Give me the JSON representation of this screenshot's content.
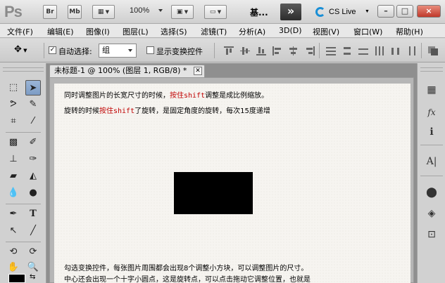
{
  "appbar": {
    "logo": "Ps",
    "bridge_label": "Br",
    "minibridge_label": "Mb",
    "zoom": "100%",
    "workspace": "基...",
    "more_arrow": "»",
    "cslive": "CS Live"
  },
  "window_buttons": {
    "minimize": "–",
    "restore": "□",
    "close": "×"
  },
  "menus": [
    "文件(F)",
    "编辑(E)",
    "图像(I)",
    "图层(L)",
    "选择(S)",
    "滤镜(T)",
    "分析(A)",
    "3D(D)",
    "视图(V)",
    "窗口(W)",
    "帮助(H)"
  ],
  "options": {
    "auto_select_label": "自动选择:",
    "auto_select_checked": true,
    "auto_select_value": "组",
    "show_transform_label": "显示变换控件",
    "show_transform_checked": false
  },
  "document": {
    "tab_title": "未标题-1 @ 100% (图层 1, RGB/8) *",
    "line1_a": "同时调整图片的长宽尺寸的时候，",
    "line1_hl": "按住shift",
    "line1_b": "调整是成比例缩放。",
    "line2_a": "旋转的时候",
    "line2_hl": "按住shift",
    "line2_b": "了旋转，是固定角度的旋转，每次15度递增",
    "line3": "勾选变换控件，每张图片周围都会出现8个调整小方块，可以调整图片的尺寸。",
    "line4": "中心还会出现一个十字小圆点，这是旋转点，可以点击拖动它调整位置，也就是"
  },
  "colors": {
    "highlight": "#c00000",
    "cslive_ring": "#1a8fd6"
  },
  "icons": {
    "tools": [
      "marquee-icon",
      "move-icon",
      "lasso-icon",
      "quick-select-icon",
      "crop-icon",
      "eyedropper-icon",
      "healing-brush-icon",
      "brush-icon",
      "clone-stamp-icon",
      "history-brush-icon",
      "eraser-icon",
      "paint-bucket-icon",
      "blur-icon",
      "dodge-icon",
      "pen-icon",
      "type-icon",
      "path-select-icon",
      "line-icon",
      "3d-rotate-icon",
      "3d-orbit-icon",
      "hand-icon",
      "zoom-icon"
    ],
    "panels": [
      "histogram-icon",
      "fx-icon",
      "info-icon",
      "character-icon",
      "channels-icon",
      "layers-icon",
      "3d-panel-icon"
    ]
  }
}
